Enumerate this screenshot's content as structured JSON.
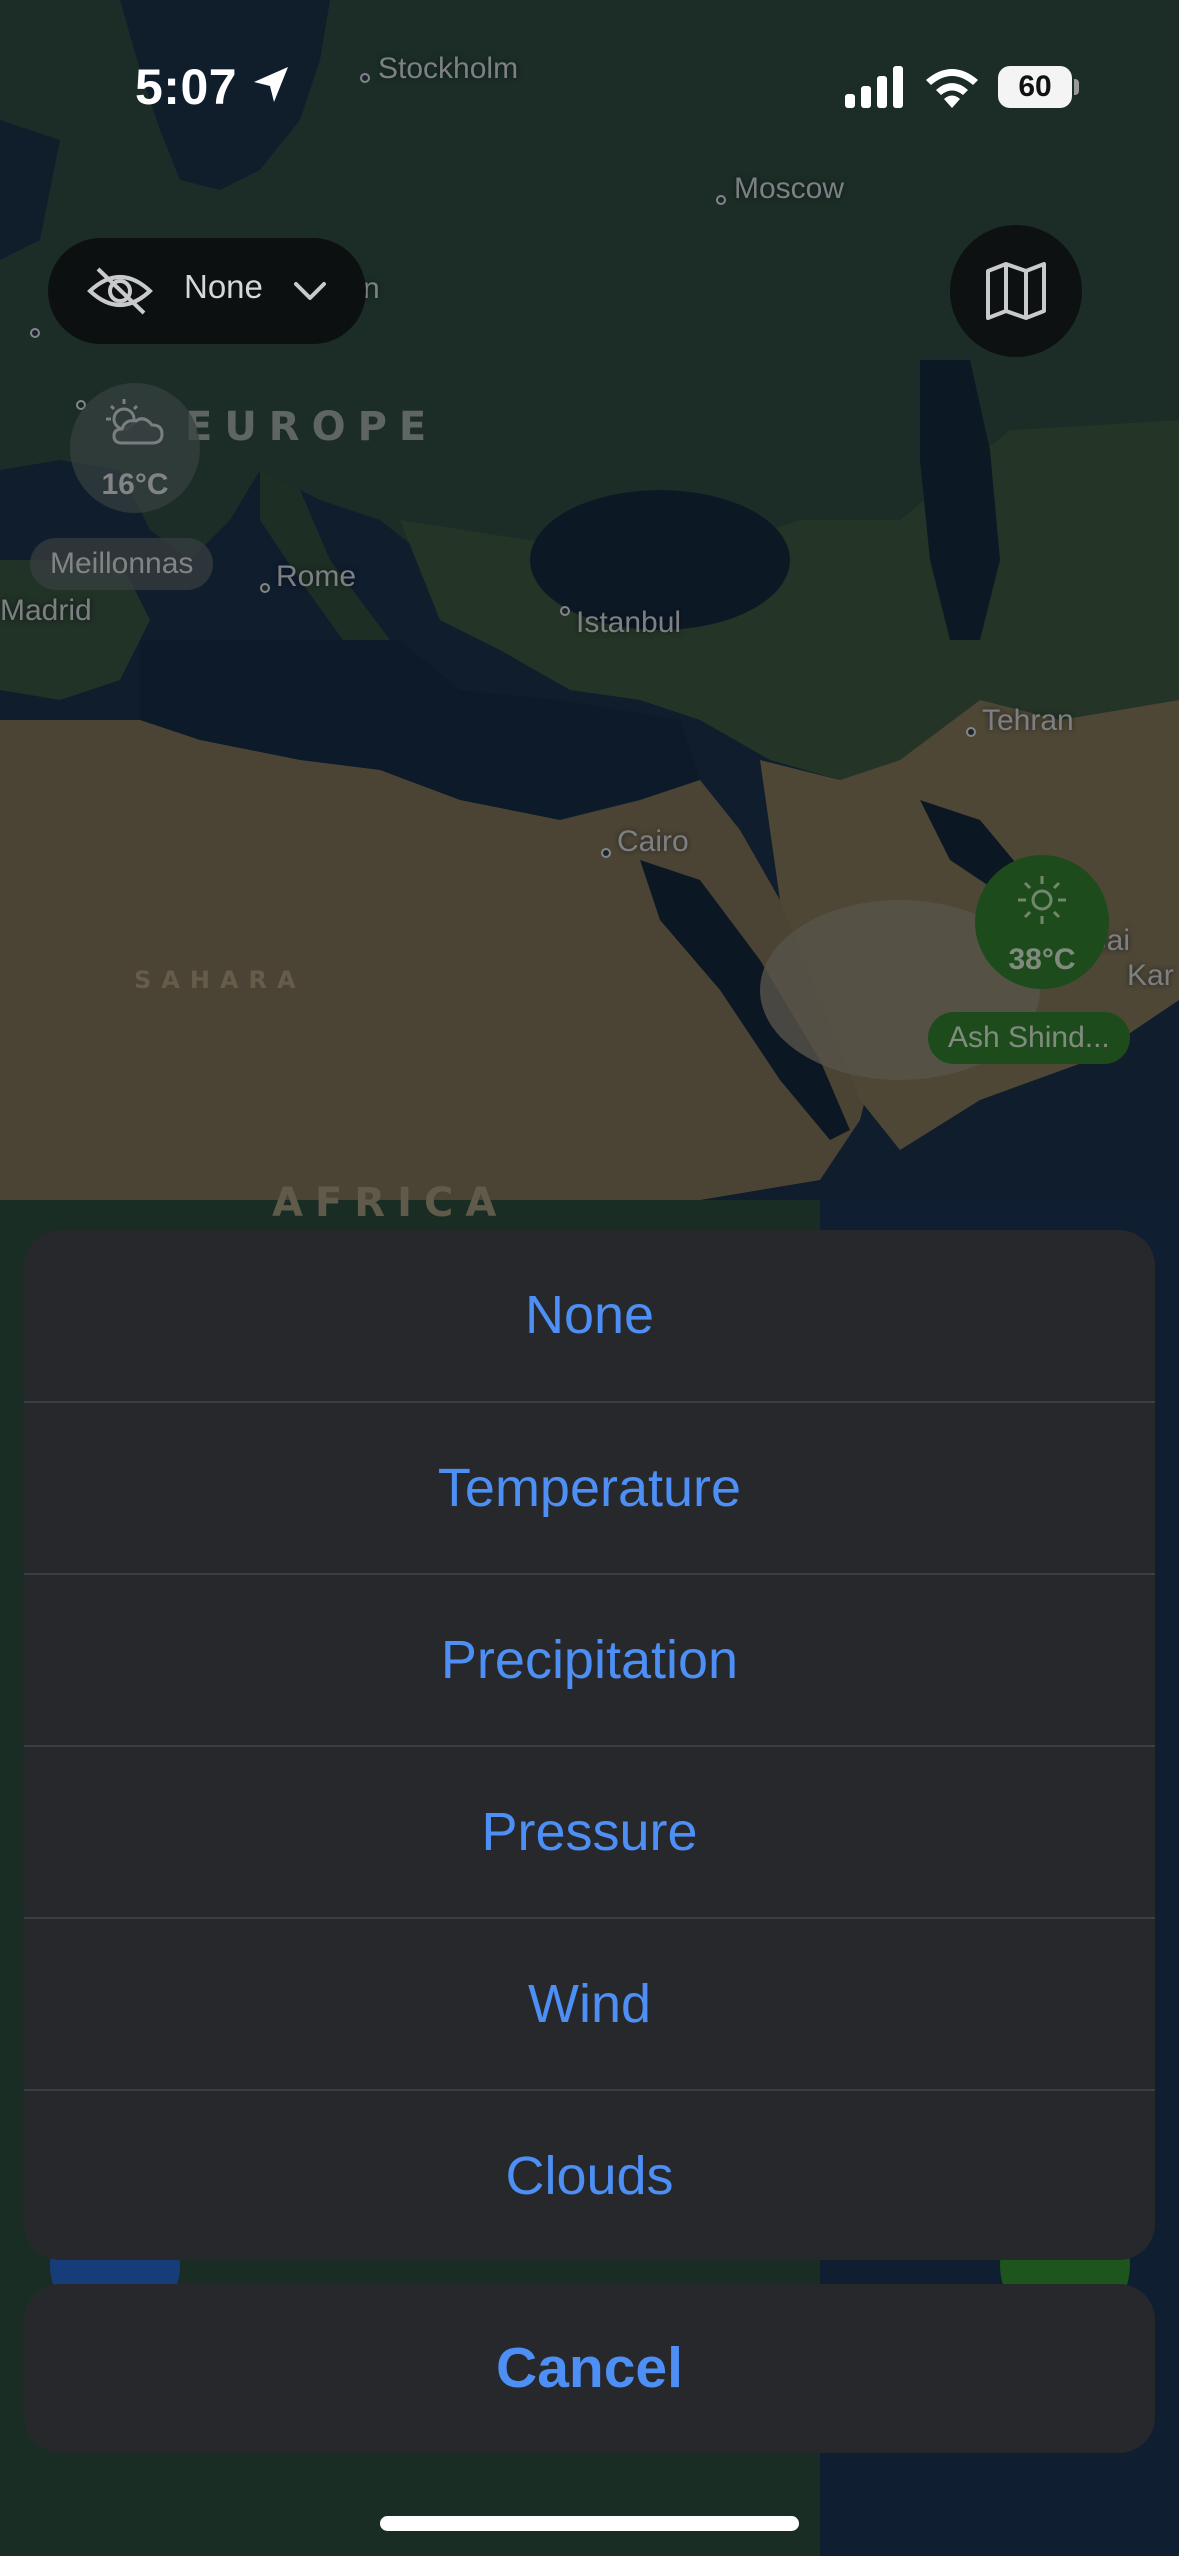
{
  "status_bar": {
    "time": "5:07",
    "battery_level": "60",
    "icons": [
      "location-arrow-icon",
      "cellular-signal-icon",
      "wifi-icon",
      "battery-icon"
    ]
  },
  "layer_selector": {
    "value": "None",
    "icons": [
      "eye-slash-icon",
      "chevron-down-icon"
    ]
  },
  "map_style_button": {
    "icon": "map-icon"
  },
  "map": {
    "cities": [
      {
        "name": "Stockholm"
      },
      {
        "name": "Moscow"
      },
      {
        "name": "Rome"
      },
      {
        "name": "Istanbul"
      },
      {
        "name": "Tehran"
      },
      {
        "name": "Cairo"
      },
      {
        "name": "Madrid"
      }
    ],
    "fragments": [
      "n",
      "bai",
      "Kar"
    ],
    "regions": [
      "EUROPE",
      "SAHARA",
      "AFRICA"
    ]
  },
  "weather_markers": [
    {
      "temp": "16°C",
      "condition_icon": "partly-cloudy-icon",
      "place": "Meillonnas",
      "color": "#4b5a5b"
    },
    {
      "temp": "38°C",
      "condition_icon": "sun-icon",
      "place": "Ash Shind...",
      "color": "#2f7a2e"
    }
  ],
  "action_sheet": {
    "options": [
      "None",
      "Temperature",
      "Precipitation",
      "Pressure",
      "Wind",
      "Clouds"
    ],
    "cancel_label": "Cancel",
    "accent_color": "#4d8ff5",
    "background_color": "#26282b"
  }
}
